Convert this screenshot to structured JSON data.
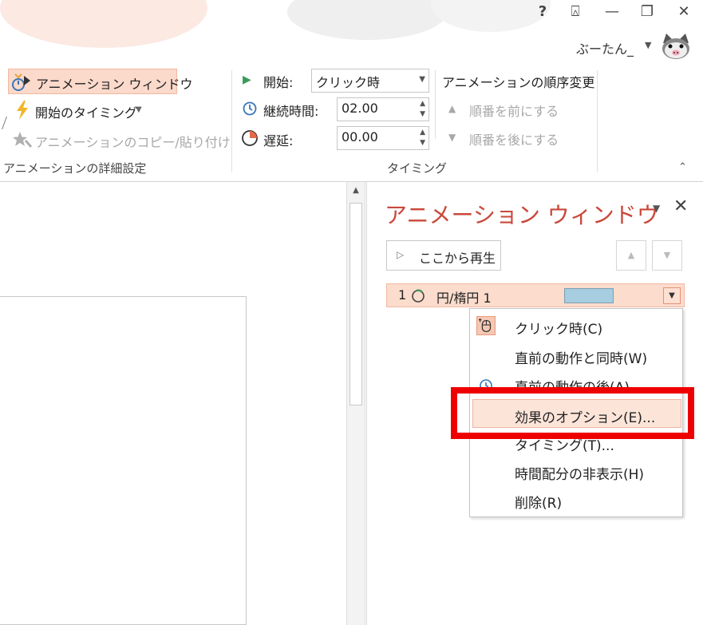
{
  "window": {
    "help": "?",
    "ribbon_display": "⍓",
    "minimize": "—",
    "restore": "❐",
    "close": "✕",
    "user_name": "ぶーたん_"
  },
  "ribbon": {
    "advanced": {
      "animation_pane_label": "アニメーション ウィンドウ",
      "trigger_label": "開始のタイミング",
      "painter_label": "アニメーションのコピー/貼り付け",
      "group_label": "アニメーションの詳細設定"
    },
    "timing": {
      "start_label": "開始:",
      "start_value": "クリック時",
      "duration_label": "継続時間:",
      "duration_value": "02.00",
      "delay_label": "遅延:",
      "delay_value": "00.00",
      "group_label": "タイミング"
    },
    "reorder": {
      "title": "アニメーションの順序変更",
      "move_earlier": "順番を前にする",
      "move_later": "順番を後にする"
    }
  },
  "pane": {
    "title": "アニメーション ウィンドウ",
    "play_label": "ここから再生",
    "item": {
      "number": "1",
      "name": "円/楕円 1"
    }
  },
  "menu": {
    "items": [
      {
        "label": "クリック時(C)"
      },
      {
        "label": "直前の動作と同時(W)"
      },
      {
        "label": "直前の動作の後(A)"
      },
      {
        "label": "効果のオプション(E)..."
      },
      {
        "label": "タイミング(T)..."
      },
      {
        "label": "時間配分の非表示(H)"
      },
      {
        "label": "削除(R)"
      }
    ]
  },
  "colors": {
    "accent": "#c9483a",
    "highlight": "#ee0000",
    "selection": "#fbdccd"
  }
}
